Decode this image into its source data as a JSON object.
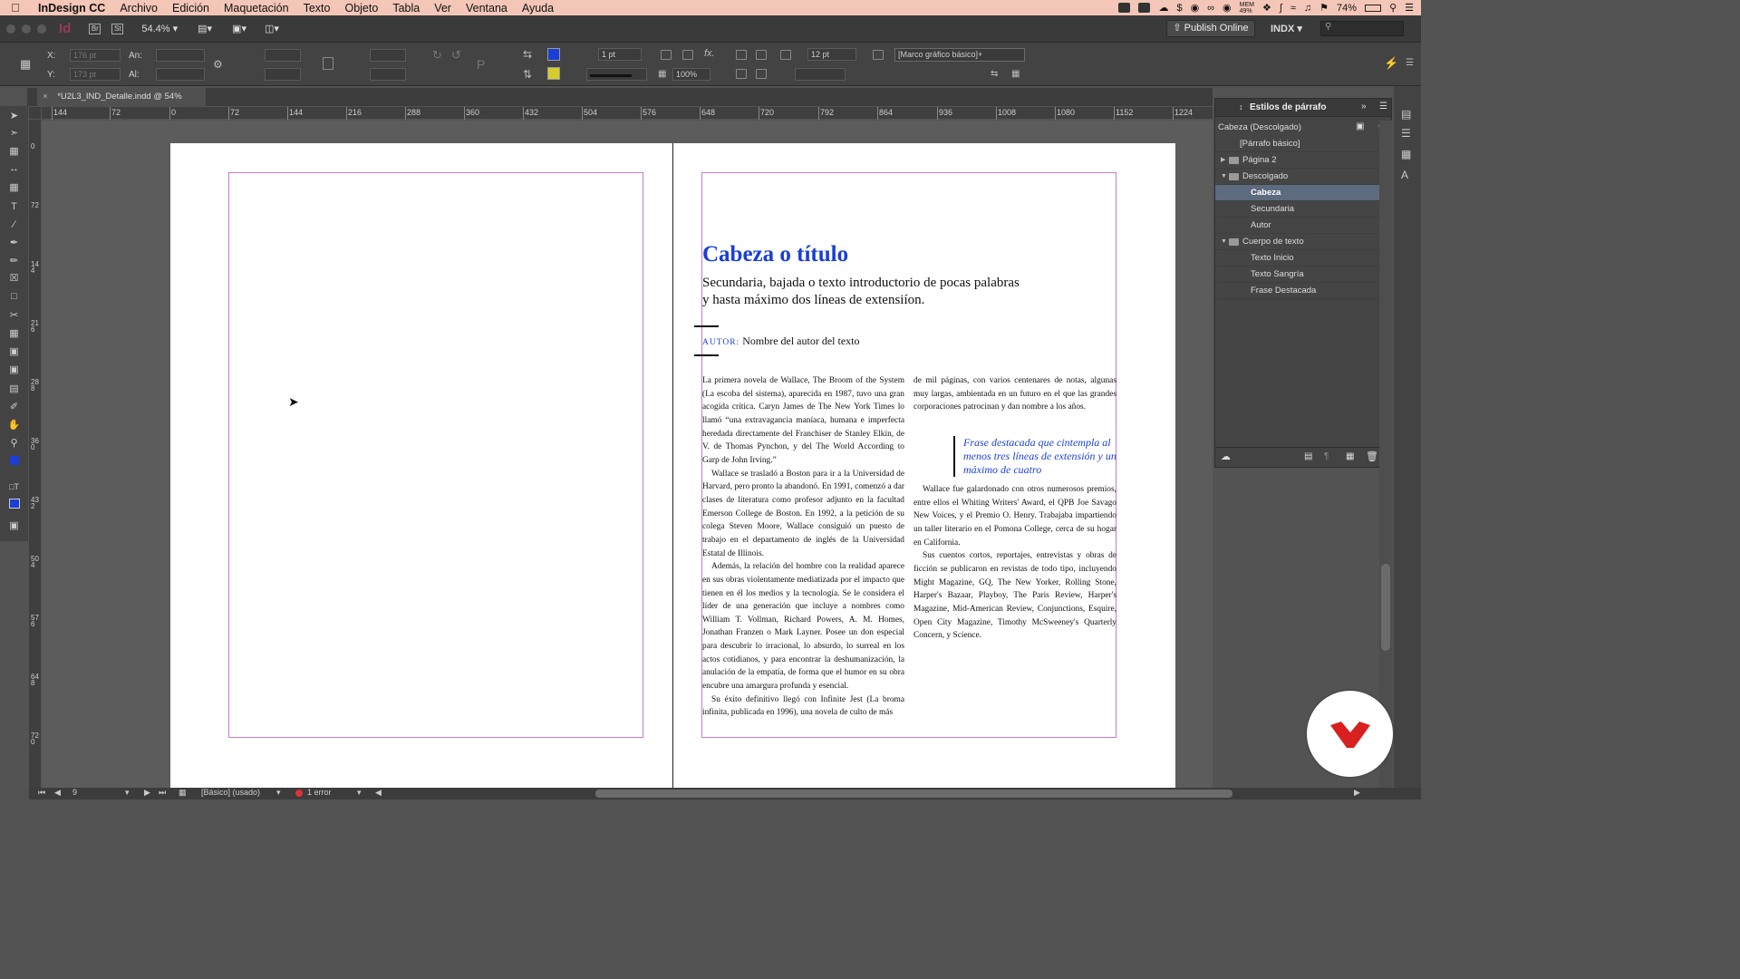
{
  "menubar": {
    "app_name": "InDesign CC",
    "items": [
      "Archivo",
      "Edición",
      "Maquetación",
      "Texto",
      "Objeto",
      "Tabla",
      "Ver",
      "Ventana",
      "Ayuda"
    ],
    "battery": "74%",
    "mem": "MEM\n49%"
  },
  "appbar": {
    "br_label": "Br",
    "st_label": "St",
    "zoom": "54.4%",
    "publish_label": "Publish Online",
    "workspace": "INDX"
  },
  "control": {
    "x_label": "X:",
    "y_label": "Y:",
    "x_value": "176 pt",
    "y_value": "173 pt",
    "w_label": "An:",
    "h_label": "Al:",
    "stroke_weight": "1 pt",
    "opacity": "100%",
    "fitting_value": "12 pt",
    "object_style": "[Marco gráfico básico]+",
    "fill_color": "#1a3fd6",
    "stroke_color": "#d6cc2a"
  },
  "tab": {
    "label": "*U2L3_IND_Detalle.indd @ 54%"
  },
  "ruler": {
    "h_ticks": [
      "144",
      "72",
      "0",
      "72",
      "144",
      "216",
      "288",
      "360",
      "432",
      "504",
      "576",
      "648",
      "720",
      "792",
      "864",
      "936",
      "1008",
      "1080",
      "1152",
      "1224"
    ],
    "v_ticks": [
      "0",
      "72",
      "144",
      "216",
      "288",
      "360",
      "432",
      "504",
      "576",
      "648",
      "720"
    ]
  },
  "document": {
    "title": "Cabeza o título",
    "subtitle": "Secundaria, bajada o texto introductorio de pocas palabras y hasta máximo dos líneas de extensiíon.",
    "author_label": "AUTOR:",
    "author_name": "Nombre del autor del texto",
    "col1": [
      "La primera novela de Wallace, The Broom of the System (La escoba del sistema), aparecida en 1987, tuvo una gran acogida crítica. Caryn James de The New York Times lo llamó “una extravagancia maníaca, humana e imperfecta heredada directamente del Franchiser de Stanley Elkin, de V. de Thomas Pynchon, y del The World According to Garp de John Irving.”",
      "Wallace se trasladó a Boston para ir a la Universidad de Harvard, pero pronto la abandonó. En 1991, comenzó a dar clases de literatura como profesor adjunto en la facultad Emerson College de Boston. En 1992, a la petición de su colega Steven Moore, Wallace consiguió un puesto de trabajo en el departamento de inglés de la Universidad Estatal de Illinois.",
      "Además, la relación del hombre con la realidad aparece en sus obras violentamente mediatizada por el impacto que tienen en él los medios y la tecnología. Se le considera el líder de una generación que incluye a nombres como William T. Vollman, Richard Powers, A. M. Homes, Jonathan Franzen o Mark Layner. Posee un don especial para descubrir lo irracional, lo absurdo, lo surreal en los actos cotidianos, y para encontrar la deshumanización, la anulación de la empatía, de forma que el humor en su obra encubre una amargura profunda y esencial.",
      "Su éxito definitivo llegó con Infinite Jest (La broma infinita, publicada en 1996), una novela de culto de más"
    ],
    "col2_top": "de mil páginas, con varios centenares de notas, algunas muy largas, ambientada en un futuro en el que las grandes corporaciones patrocinan y dan nombre a los años.",
    "pullquote": "Frase destacada que cintempla al menos tres líneas de extensión y un máximo de cuatro",
    "col2": [
      "Wallace fue galardonado con otros numerosos premios, entre ellos el Whiting Writers' Award, el QPB Joe Savago New Voices, y el Premio O. Henry. Trabajaba impartiendo un taller literario en el Pomona College, cerca de su hogar en California.",
      "Sus cuentos cortos, reportajes, entrevistas y obras de ficción se publicaron en revistas de todo tipo, incluyendo Might Magazine, GQ, The New Yorker, Rolling Stone, Harper's Bazaar, Playboy, The Paris Review, Harper's Magazine, Mid-American Review, Conjunctions, Esquire, Open City Magazine, Timothy McSweeney's Quarterly Concern, y Science."
    ]
  },
  "styles_panel": {
    "title": "Estilos de párrafo",
    "current": "Cabeza (Descolgado)",
    "rows": [
      {
        "label": "[Párrafo básico]",
        "kind": "style",
        "level": 1
      },
      {
        "label": "Página 2",
        "kind": "group-closed",
        "level": 0
      },
      {
        "label": "Descolgado",
        "kind": "group-open",
        "level": 0
      },
      {
        "label": "Cabeza",
        "kind": "style",
        "level": 2,
        "selected": true
      },
      {
        "label": "Secundaria",
        "kind": "style",
        "level": 2
      },
      {
        "label": "Autor",
        "kind": "style",
        "level": 2
      },
      {
        "label": "Cuerpo de texto",
        "kind": "group-open",
        "level": 0
      },
      {
        "label": "Texto Inicio",
        "kind": "style",
        "level": 2
      },
      {
        "label": "Texto Sangría",
        "kind": "style",
        "level": 2
      },
      {
        "label": "Frase Destacada",
        "kind": "style",
        "level": 2
      }
    ]
  },
  "status": {
    "page": "9",
    "master": "[Básico] (usado)",
    "errors": "1 error"
  }
}
